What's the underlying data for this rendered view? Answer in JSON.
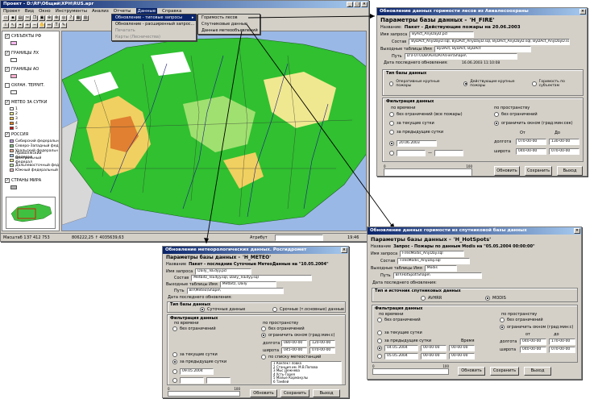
{
  "main": {
    "title": "Проект - D:\\RF\\Общий\\ХРН\\RUS.apr",
    "menu": [
      "Проект",
      "Вид",
      "Окно",
      "Инструменты",
      "Анализ",
      "Отчеты",
      "Данные",
      "Справка"
    ],
    "active_menu": "Данные",
    "data_menu": {
      "items": [
        {
          "label": "Обновление - типовые запросы",
          "state": "selected"
        },
        {
          "label": "Обновление - расширенный запрос...",
          "state": "normal"
        },
        {
          "label": "Печатать",
          "state": "disabled"
        },
        {
          "label": "Карты (Лесничества)",
          "state": "disabled"
        }
      ],
      "submenu": [
        "Горимость лесов",
        "Спутниковые данные",
        "Данные метеообъявлений"
      ]
    },
    "layers": [
      {
        "name": "СУБЪЕКТЫ РФ",
        "checked": true
      },
      {
        "name": "ГРАНИЦЫ ЛХ",
        "checked": true
      },
      {
        "name": "ГРАНИЦЫ АО",
        "checked": true
      },
      {
        "name": "ОХРАН. ТЕРРИТ.",
        "checked": false
      },
      {
        "name": "МЕТЕО ЗА СУТКИ",
        "checked": true
      },
      {
        "name": "РОССИЯ",
        "checked": true
      },
      {
        "name": "СТРАНЫ МИРА",
        "checked": true
      }
    ],
    "meteo_classes": [
      "1",
      "2",
      "3",
      "4",
      "5"
    ],
    "russia_districts": [
      "Сибирский федеральн",
      "Северо-Западный фед",
      "Уральский федеральн",
      "Приволжский федерал",
      "Центральный федерал",
      "Дальневосточный фед",
      "Южный федеральный"
    ],
    "status": {
      "scale": "Масштаб 1 :",
      "scale_value": "37 412 753",
      "coords": "806222,25 ↑ 4035639,63",
      "attr_label": "Атрибут",
      "time": "19:46"
    }
  },
  "fire_window": {
    "title": "Обновление данных горимости лесов из Авиалесоохраны",
    "params_label": "Параметры базы данных -",
    "params_value": "'Н_FIRE'",
    "name_label": "Название:",
    "name_value": "Пакет - Действующие пожары на 20.06.2003",
    "query_label": "Имя запроса",
    "query_value": "ByAct_AnyDayD.pcl",
    "compose_label": "Состав",
    "compose_value": "ByDAct_AnyDayD.sql, ByDAct_AnyDayD.sql, ByDAct_AnyDayD.sql, ByDAct_AnyDayD.sql",
    "out_label": "Выходные таблицы Имя",
    "out_value": "ByDAct, ByDAct, ByDAct",
    "path_label": "Путь",
    "path_value": "D:\\FOTODB\\PERDATA\\Fier\\Shape\\",
    "date_label": "Дата последнего обновления:",
    "date_value": "16.06.2003 11:10:08",
    "type_group": "Тип базы данных",
    "types": [
      {
        "label": "Оперативные крупные пожары",
        "on": false
      },
      {
        "label": "Действующие крупные пожары",
        "on": true
      },
      {
        "label": "Горимость по субъектам",
        "on": false
      }
    ],
    "filter_group": "Фильтрация данных",
    "by_time": "по времени",
    "time_opts": [
      {
        "label": "без ограничений (все пожары)",
        "on": false
      },
      {
        "label": "за текущие сутки",
        "on": false
      },
      {
        "label": "за предыдущие сутки",
        "on": false
      }
    ],
    "date_field": "20.06.2003",
    "by_space": "по пространству",
    "space_opts": [
      {
        "label": "без ограничений",
        "on": false
      },
      {
        "label": "ограничить окном (град:мин:сек)",
        "on": true
      }
    ],
    "from": "От",
    "to": "До",
    "lon_label": "долгота",
    "lon_from": "070-00-00",
    "lon_to": "130-00-00",
    "lat_label": "широта",
    "lat_from": "040-00-00",
    "lat_to": "070-00-00",
    "progress_ticks": [
      "0",
      "100"
    ],
    "btn_update": "Обновить",
    "btn_save": "Сохранить",
    "btn_exit": "Выход"
  },
  "meteo_window": {
    "title": "Обновление метеорологических данных. Росгидромет",
    "params_label": "Параметры базы данных -",
    "params_value": "'Н_METEO'",
    "name_label": "Название",
    "name_value": "Пакет - последние Суточные МетеоДанные на \"10.05.2004\"",
    "query_label": "Имя запроса",
    "query_value": "Daily_TsEdyy.pcl",
    "compose_label": "Состав",
    "compose_value": "Metbitz_TsEdyy.sql, Daily_TsEdyy.sql",
    "out_label": "Выходные таблицы Имя",
    "out_value": "Metbitz, Daily",
    "path_label": "Путь",
    "path_value": "ВЛ\\Meteo\\Shape\\",
    "date_label": "Дата последнего обновления:",
    "type_group": "Тип базы данных",
    "types": [
      {
        "label": "Суточные данные",
        "on": true
      },
      {
        "label": "Срочные (т.основные) данные",
        "on": false
      }
    ],
    "filter_group": "Фильтрация данных",
    "by_time": "по времени",
    "time_opts": [
      {
        "label": "без ограничений",
        "on": false
      },
      {
        "label": "за текущие сутки",
        "on": false
      },
      {
        "label": "за предыдущие сутки",
        "on": true
      }
    ],
    "date_field": "09.05.2004",
    "by_space": "по пространству",
    "space_opts": [
      {
        "label": "без ограничений",
        "on": false
      },
      {
        "label": "ограничить окном (град:мин:с)",
        "on": true
      }
    ],
    "lon_label": "долгота",
    "lon_from": "080-00-00",
    "lon_to": "120-00-00",
    "lat_label": "широта",
    "lat_from": "045-00-00",
    "lat_to": "070-00-00",
    "stations_label": "по списку метеостанций",
    "stations": [
      "1 Кокпек Гловка",
      "2 Станция им. М.В.Попова",
      "3 Мыс Дежнева",
      "4 Усть-Тарея",
      "5 Малые Кармакулы",
      "6 Тамбей"
    ],
    "progress_ticks": [
      "0",
      "100"
    ],
    "btn_update": "Обновить",
    "btn_save": "Сохранить",
    "btn_exit": "Выход"
  },
  "sat_window": {
    "title": "Обновление данных горимости из спутниковой базы данных",
    "params_label": "Параметры базы данных -",
    "params_value": "'Н_HotSpots'",
    "name_label": "Название",
    "name_value": "Запрос - Пожары по данным Modis на \"05.05.2004 00:00:00\"",
    "query_label": "Имя запроса",
    "query_value": "FiresModis_AnyDay.sql",
    "compose_label": "Состав",
    "compose_value": "FiresModis_AnyDay.sql",
    "out_label": "Выходные таблицы Имя",
    "out_value": "Modis",
    "path_label": "Путь",
    "path_value": "ВЛ\\HotSpot\\Shape\\",
    "date_label": "Дата последнего обновления:",
    "type_group": "Тип и источник спутниковых данных",
    "types": [
      {
        "label": "AVHRR",
        "on": false
      },
      {
        "label": "MODIS",
        "on": true
      }
    ],
    "filter_group": "Фильтрация данных",
    "by_time": "по времени",
    "time_opts": [
      {
        "label": "без ограничений",
        "on": false
      },
      {
        "label": "за текущие сутки",
        "on": false
      },
      {
        "label": "за предыдущие сутки",
        "on": false
      }
    ],
    "date_from": "04.05.2004",
    "time_from": "00-00-00",
    "date_to": "05.05.2004",
    "time_to": "00-00-00",
    "time_word": "Время",
    "by_space": "по пространству",
    "space_opts": [
      {
        "label": "без ограничений",
        "on": false
      },
      {
        "label": "ограничить окном (град:мин:с)",
        "on": true
      }
    ],
    "from": "от",
    "to": "до",
    "lon_label": "долгота",
    "lon_from": "040-00-00",
    "lon_to": "170-00-00",
    "lat_label": "широта",
    "lat_from": "040-00-00",
    "lat_to": "070-00-00",
    "progress_ticks": [
      "0",
      "100"
    ],
    "btn_update": "Обновить",
    "btn_save": "Сохранить",
    "btn_exit": "Выход"
  }
}
